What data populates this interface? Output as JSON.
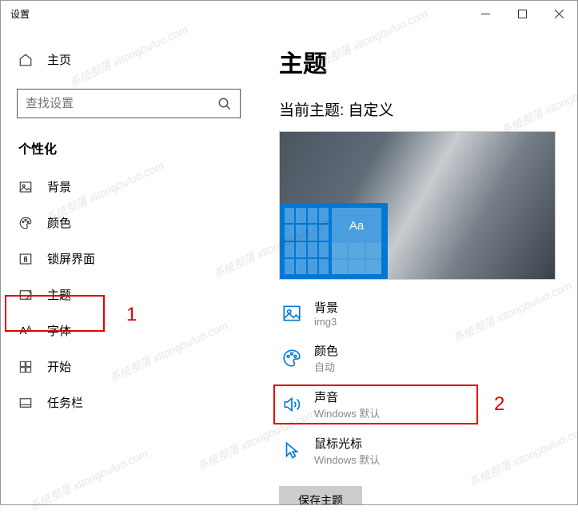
{
  "window": {
    "title": "设置"
  },
  "sidebar": {
    "home": "主页",
    "search_placeholder": "查找设置",
    "category": "个性化",
    "items": [
      {
        "label": "背景"
      },
      {
        "label": "颜色"
      },
      {
        "label": "锁屏界面"
      },
      {
        "label": "主题"
      },
      {
        "label": "字体"
      },
      {
        "label": "开始"
      },
      {
        "label": "任务栏"
      }
    ]
  },
  "main": {
    "title": "主题",
    "current_theme_label": "当前主题: 自定义",
    "preview_aa": "Aa",
    "props": [
      {
        "label": "背景",
        "value": "img3"
      },
      {
        "label": "颜色",
        "value": "自动"
      },
      {
        "label": "声音",
        "value": "Windows 默认"
      },
      {
        "label": "鼠标光标",
        "value": "Windows 默认"
      }
    ],
    "save_button": "保存主题"
  },
  "annotations": {
    "num1": "1",
    "num2": "2"
  },
  "watermark": "系统部落 xitongbuluo.com"
}
